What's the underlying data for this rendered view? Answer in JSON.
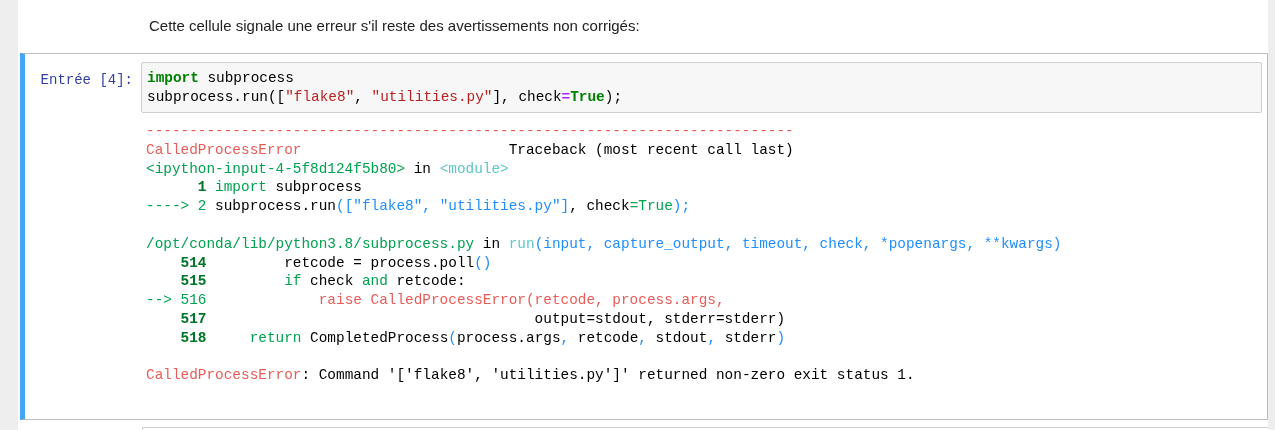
{
  "markdown": {
    "text": "Cette cellule signale une erreur s'il reste des avertissements non corrigés:"
  },
  "cell": {
    "prompt": "Entrée [4]:",
    "selected": true,
    "input": [
      {
        "kind": "text",
        "segments": [
          {
            "text": "import",
            "kind": "keyword"
          },
          {
            "text": " subprocess",
            "kind": "plain"
          }
        ]
      },
      {
        "kind": "text",
        "segments": [
          {
            "text": "subprocess.run([",
            "kind": "plain"
          },
          {
            "text": "\"flake8\"",
            "kind": "string"
          },
          {
            "text": ", ",
            "kind": "plain"
          },
          {
            "text": "\"utilities.py\"",
            "kind": "string"
          },
          {
            "text": "], check",
            "kind": "plain"
          },
          {
            "text": "=",
            "kind": "operator"
          },
          {
            "text": "True",
            "kind": "keyword"
          },
          {
            "text": ");",
            "kind": "plain"
          }
        ]
      }
    ],
    "output": [
      {
        "kind": "text",
        "segments": [
          {
            "text": "---------------------------------------------------------------------------",
            "kind": "red"
          }
        ]
      },
      {
        "kind": "text",
        "segments": [
          {
            "text": "CalledProcessError",
            "kind": "red"
          },
          {
            "text": "                        Traceback (most recent call last)",
            "kind": "plain"
          }
        ]
      },
      {
        "kind": "text",
        "segments": [
          {
            "text": "<ipython-input-4-5f8d124f5b80>",
            "kind": "green"
          },
          {
            "text": " in ",
            "kind": "plain"
          },
          {
            "text": "<module>",
            "kind": "cyan"
          }
        ]
      },
      {
        "kind": "text",
        "segments": [
          {
            "text": "      1",
            "kind": "green-bold"
          },
          {
            "text": " import",
            "kind": "green"
          },
          {
            "text": " subprocess",
            "kind": "plain"
          }
        ]
      },
      {
        "kind": "text",
        "segments": [
          {
            "text": "----> 2",
            "kind": "green"
          },
          {
            "text": " subprocess.run",
            "kind": "plain"
          },
          {
            "text": "([\"flake8\", \"utilities.py\"]",
            "kind": "blue"
          },
          {
            "text": ", check",
            "kind": "plain"
          },
          {
            "text": "=True",
            "kind": "green"
          },
          {
            "text": ");",
            "kind": "blue"
          }
        ]
      },
      {
        "kind": "blank"
      },
      {
        "kind": "text",
        "segments": [
          {
            "text": "/opt/conda/lib/python3.8/subprocess.py",
            "kind": "green"
          },
          {
            "text": " in ",
            "kind": "plain"
          },
          {
            "text": "run",
            "kind": "cyan"
          },
          {
            "text": "(input, capture_output, timeout, check, *popenargs, **kwargs)",
            "kind": "blue"
          }
        ]
      },
      {
        "kind": "text",
        "segments": [
          {
            "text": "    514",
            "kind": "green-bold"
          },
          {
            "text": "         retcode = process.poll",
            "kind": "plain"
          },
          {
            "text": "()",
            "kind": "blue"
          }
        ]
      },
      {
        "kind": "text",
        "segments": [
          {
            "text": "    515",
            "kind": "green-bold"
          },
          {
            "text": "         if",
            "kind": "green"
          },
          {
            "text": " check ",
            "kind": "plain"
          },
          {
            "text": "and",
            "kind": "green"
          },
          {
            "text": " retcode:",
            "kind": "plain"
          }
        ]
      },
      {
        "kind": "text",
        "segments": [
          {
            "text": "--> 516",
            "kind": "green"
          },
          {
            "text": "             raise CalledProcessError(retcode, process.args,",
            "kind": "red"
          }
        ]
      },
      {
        "kind": "text",
        "segments": [
          {
            "text": "    517",
            "kind": "green-bold"
          },
          {
            "text": "                                      output=stdout, stderr=stderr)",
            "kind": "plain"
          }
        ]
      },
      {
        "kind": "text",
        "segments": [
          {
            "text": "    518",
            "kind": "green-bold"
          },
          {
            "text": "     return",
            "kind": "green"
          },
          {
            "text": " CompletedProcess",
            "kind": "plain"
          },
          {
            "text": "(",
            "kind": "blue"
          },
          {
            "text": "process.args",
            "kind": "plain"
          },
          {
            "text": ",",
            "kind": "blue"
          },
          {
            "text": " retcode",
            "kind": "plain"
          },
          {
            "text": ",",
            "kind": "blue"
          },
          {
            "text": " stdout",
            "kind": "plain"
          },
          {
            "text": ",",
            "kind": "blue"
          },
          {
            "text": " stderr",
            "kind": "plain"
          },
          {
            "text": ")",
            "kind": "blue"
          }
        ]
      },
      {
        "kind": "blank"
      },
      {
        "kind": "text",
        "segments": [
          {
            "text": "CalledProcessError",
            "kind": "red"
          },
          {
            "text": ": Command '['flake8', 'utilities.py']' returned non-zero exit status 1.",
            "kind": "plain"
          }
        ]
      }
    ]
  }
}
